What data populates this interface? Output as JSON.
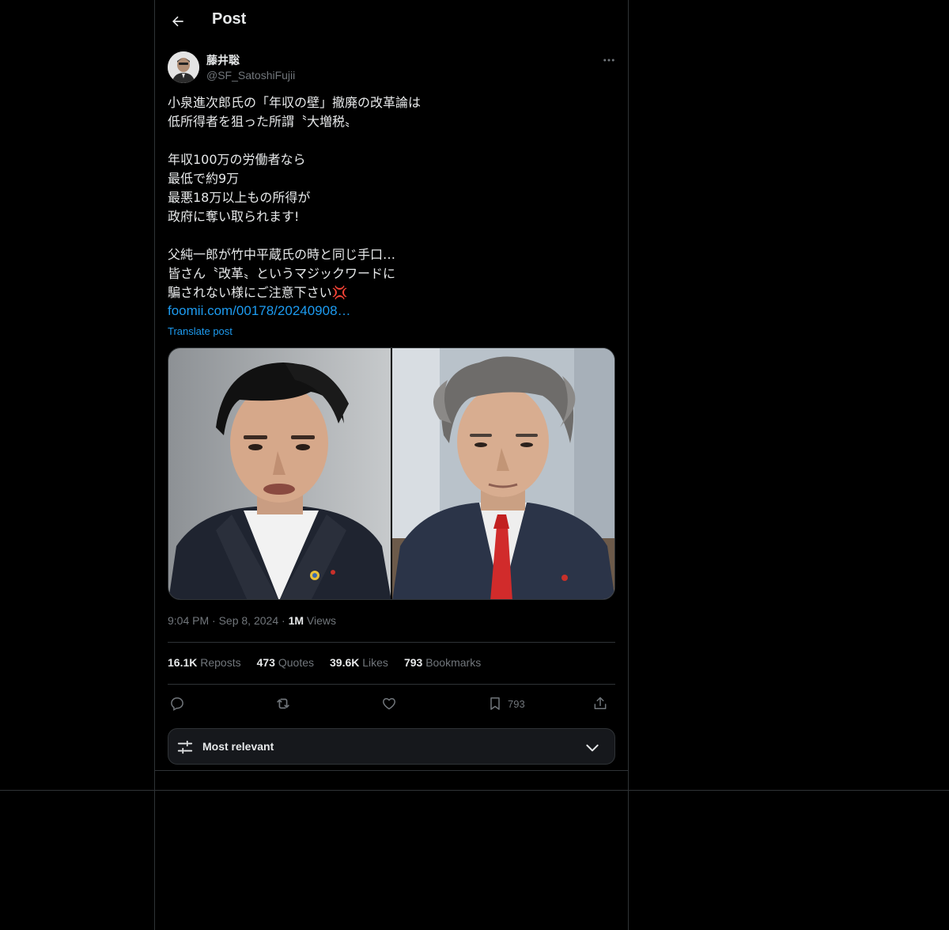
{
  "header": {
    "title": "Post"
  },
  "author": {
    "name": "藤井聡",
    "handle": "@SF_SatoshiFujii"
  },
  "post": {
    "lines": [
      "小泉進次郎氏の「年収の壁」撤廃の改革論は",
      "低所得者を狙った所謂〝大増税〟",
      "",
      "年収100万の労働者なら",
      "最低で約9万",
      "最悪18万以上もの所得が",
      "政府に奪い取られます!",
      "",
      "父純一郎が竹中平蔵氏の時と同じ手口…",
      "皆さん〝改革〟というマジックワードに",
      "騙されない様にご注意下さい💢"
    ],
    "link": "foomii.com/00178/20240908…",
    "translate": "Translate post"
  },
  "meta": {
    "time": "9:04 PM",
    "date": "Sep 8, 2024",
    "views_count": "1M",
    "views_label": "Views"
  },
  "stats": {
    "reposts_count": "16.1K",
    "reposts_label": "Reposts",
    "quotes_count": "473",
    "quotes_label": "Quotes",
    "likes_count": "39.6K",
    "likes_label": "Likes",
    "bookmarks_count": "793",
    "bookmarks_label": "Bookmarks"
  },
  "actions": {
    "bookmark_count": "793"
  },
  "sort": {
    "label": "Most relevant"
  },
  "icons": {
    "back": "arrow-left-icon",
    "more": "more-horizontal-icon",
    "reply": "reply-icon",
    "repost": "repost-icon",
    "like": "heart-icon",
    "bookmark": "bookmark-icon",
    "share": "share-icon",
    "sort": "sliders-icon",
    "chevron": "chevron-down-icon"
  },
  "colors": {
    "background": "#000000",
    "text": "#e7e9ea",
    "muted": "#71767b",
    "link": "#1d9bf0",
    "border": "#2f3336"
  }
}
